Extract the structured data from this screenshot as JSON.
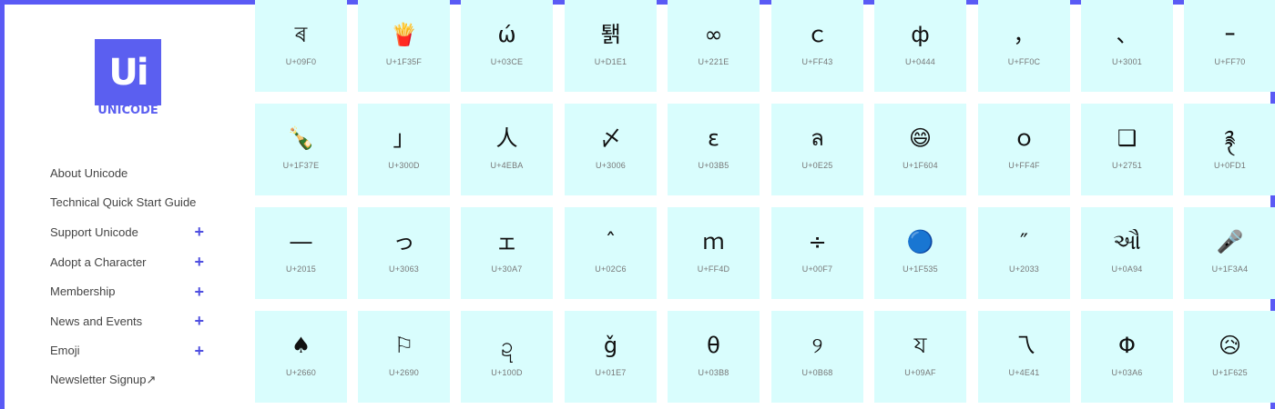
{
  "logo": {
    "mark": "Ui",
    "text": "UNICODE"
  },
  "nav": [
    {
      "label": "About Unicode",
      "expandable": false
    },
    {
      "label": "Technical Quick Start Guide",
      "expandable": false
    },
    {
      "label": "Support Unicode",
      "expandable": true
    },
    {
      "label": "Adopt a Character",
      "expandable": true
    },
    {
      "label": "Membership",
      "expandable": true
    },
    {
      "label": "News and Events",
      "expandable": true
    },
    {
      "label": "Emoji",
      "expandable": true
    },
    {
      "label": "Newsletter Signup↗",
      "expandable": false
    }
  ],
  "expand_symbol": "+",
  "characters": [
    [
      {
        "glyph": "ৰ",
        "code": "U+09F0"
      },
      {
        "glyph": "🍟",
        "code": "U+1F35F"
      },
      {
        "glyph": "ώ",
        "code": "U+03CE"
      },
      {
        "glyph": "퇡",
        "code": "U+D1E1"
      },
      {
        "glyph": "∞",
        "code": "U+221E"
      },
      {
        "glyph": "ｃ",
        "code": "U+FF43"
      },
      {
        "glyph": "ф",
        "code": "U+0444"
      },
      {
        "glyph": "，",
        "code": "U+FF0C"
      },
      {
        "glyph": "、",
        "code": "U+3001"
      },
      {
        "glyph": "ｰ",
        "code": "U+FF70"
      }
    ],
    [
      {
        "glyph": "🍾",
        "code": "U+1F37E"
      },
      {
        "glyph": "」",
        "code": "U+300D"
      },
      {
        "glyph": "人",
        "code": "U+4EBA"
      },
      {
        "glyph": "〆",
        "code": "U+3006"
      },
      {
        "glyph": "ε",
        "code": "U+03B5"
      },
      {
        "glyph": "ล",
        "code": "U+0E25"
      },
      {
        "glyph": "😄",
        "code": "U+1F604"
      },
      {
        "glyph": "ｏ",
        "code": "U+FF4F"
      },
      {
        "glyph": "❑",
        "code": "U+2751"
      },
      {
        "glyph": "࿑",
        "code": "U+0FD1"
      }
    ],
    [
      {
        "glyph": "―",
        "code": "U+2015"
      },
      {
        "glyph": "っ",
        "code": "U+3063"
      },
      {
        "glyph": "ェ",
        "code": "U+30A7"
      },
      {
        "glyph": "ˆ",
        "code": "U+02C6"
      },
      {
        "glyph": "ｍ",
        "code": "U+FF4D"
      },
      {
        "glyph": "÷",
        "code": "U+00F7"
      },
      {
        "glyph": "🔵",
        "code": "U+1F535"
      },
      {
        "glyph": "″",
        "code": "U+2033"
      },
      {
        "glyph": "ઔ",
        "code": "U+0A94"
      },
      {
        "glyph": "🎤",
        "code": "U+1F3A4"
      }
    ],
    [
      {
        "glyph": "♠",
        "code": "U+2660"
      },
      {
        "glyph": "⚐",
        "code": "U+2690"
      },
      {
        "glyph": "ဍ",
        "code": "U+100D"
      },
      {
        "glyph": "ǧ",
        "code": "U+01E7"
      },
      {
        "glyph": "θ",
        "code": "U+03B8"
      },
      {
        "glyph": "୨",
        "code": "U+0B68"
      },
      {
        "glyph": "য",
        "code": "U+09AF"
      },
      {
        "glyph": "乁",
        "code": "U+4E41"
      },
      {
        "glyph": "Φ",
        "code": "U+03A6"
      },
      {
        "glyph": "😥",
        "code": "U+1F625"
      }
    ]
  ]
}
